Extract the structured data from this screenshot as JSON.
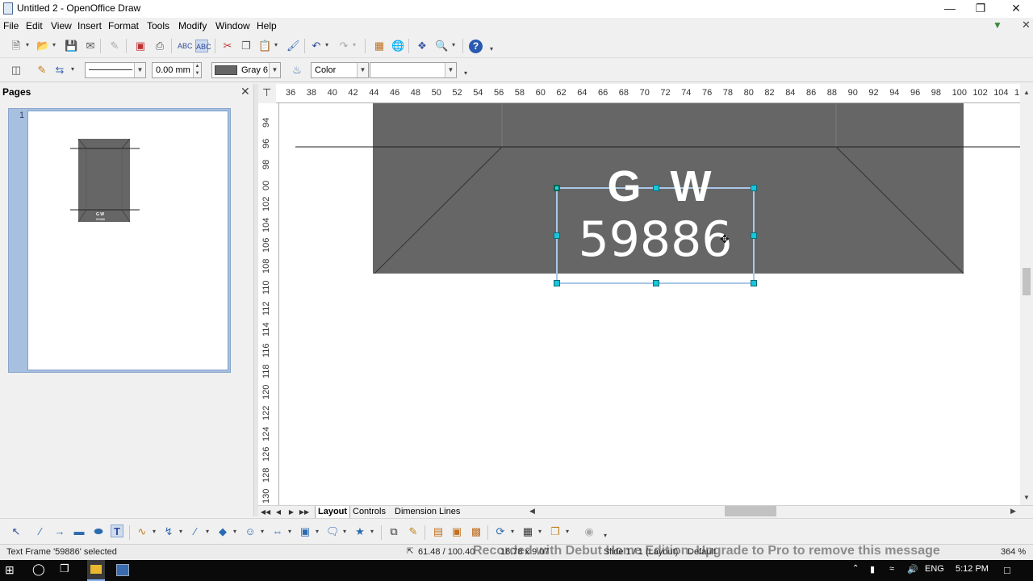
{
  "window": {
    "title": "Untitled 2 - OpenOffice Draw",
    "minimize_icon": "minimize-icon",
    "restore_icon": "restore-icon",
    "close_icon": "close-icon"
  },
  "menu": {
    "file": "File",
    "edit": "Edit",
    "view": "View",
    "insert": "Insert",
    "format": "Format",
    "tools": "Tools",
    "modify": "Modify",
    "window": "Window",
    "help": "Help"
  },
  "toolbar2": {
    "line_width": "0.00 mm",
    "area_color_name": "Gray 6",
    "area_style": "Color",
    "area_fill": ""
  },
  "pages_panel": {
    "title": "Pages",
    "page_number": "1",
    "thumb_text_1": "G  W",
    "thumb_text_2": "59886"
  },
  "hruler": [
    "36",
    "38",
    "40",
    "42",
    "44",
    "46",
    "48",
    "50",
    "52",
    "54",
    "56",
    "58",
    "60",
    "62",
    "64",
    "66",
    "68",
    "70",
    "72",
    "74",
    "76",
    "78",
    "80",
    "82",
    "84",
    "86",
    "88",
    "90",
    "92",
    "94",
    "96",
    "98",
    "100",
    "102",
    "104",
    "1"
  ],
  "vruler": [
    "94",
    "96",
    "98",
    "00",
    "102",
    "104",
    "106",
    "108",
    "110",
    "112",
    "114",
    "116",
    "118",
    "120",
    "122",
    "124",
    "126",
    "128",
    "130"
  ],
  "canvas": {
    "text_line_1": "G  W",
    "text_line_2": "59886",
    "shape_color": "#666667"
  },
  "tabs": {
    "layout": "Layout",
    "controls": "Controls",
    "dimension_lines": "Dimension Lines"
  },
  "status": {
    "selection": "Text Frame '59886' selected",
    "position": "61.48 / 100.40",
    "size": "18.78 x 9.07",
    "slide": "Slide 1 / 1 (Layout)",
    "master": "Default",
    "zoom": "364 %",
    "watermark": "Recorded with Debut Home Edition. Upgrade to Pro to remove this message"
  },
  "taskbar": {
    "language": "ENG",
    "time": "5:12 PM"
  }
}
